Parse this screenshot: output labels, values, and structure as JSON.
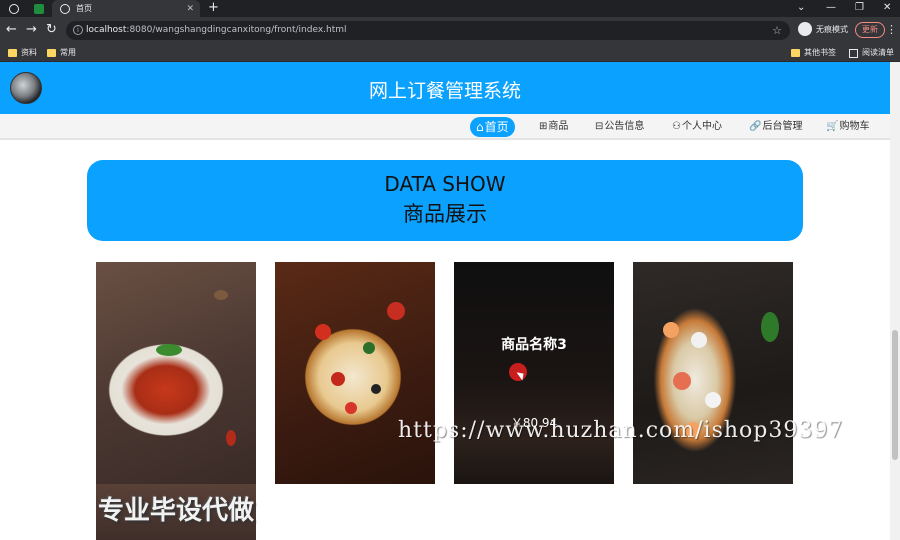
{
  "browser": {
    "active_tab_title": "首页",
    "url_host": "localhost",
    "url_rest": ":8080/wangshangdingcanxitong/front/index.html",
    "incognito_label": "无痕模式",
    "update_label": "更新",
    "bookmarks": [
      "资料",
      "常用"
    ],
    "bookmarks_right": [
      "其他书签",
      "阅读清单"
    ]
  },
  "site": {
    "title": "网上订餐管理系统",
    "nav": [
      {
        "icon": "⌂",
        "label": "首页"
      },
      {
        "icon": "⊞",
        "label": "商品"
      },
      {
        "icon": "⊟",
        "label": "公告信息"
      },
      {
        "icon": "⚇",
        "label": "个人中心"
      },
      {
        "icon": "🔗",
        "label": "后台管理"
      },
      {
        "icon": "🛒",
        "label": "购物车"
      }
    ]
  },
  "section": {
    "title_en": "DATA SHOW",
    "title_zh": "商品展示"
  },
  "products": {
    "hover_name": "商品名称3",
    "hover_price": "￥80.94"
  },
  "overlays": {
    "watermark_url": "https://www.huzhan.com/ishop39397",
    "watermark_text": "专业毕设代做"
  },
  "colors": {
    "primary": "#0aa1ff"
  }
}
